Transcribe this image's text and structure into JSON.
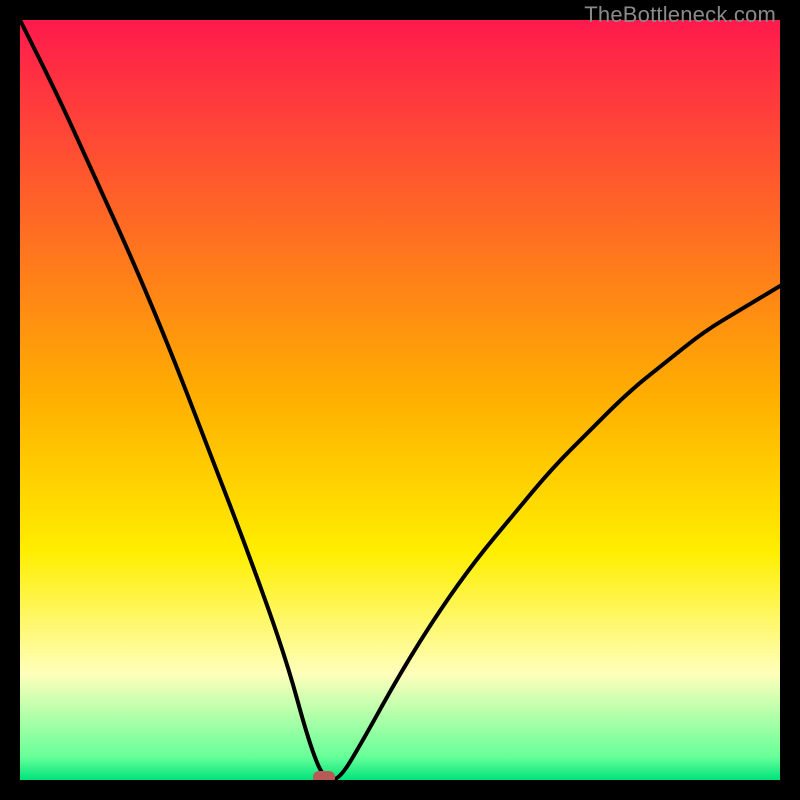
{
  "watermark": "TheBottleneck.com",
  "chart_data": {
    "type": "line",
    "title": "",
    "xlabel": "",
    "ylabel": "",
    "xlim": [
      0,
      100
    ],
    "ylim": [
      0,
      100
    ],
    "grid": false,
    "legend": false,
    "marker": {
      "x": 40,
      "y": 0,
      "color": "#b85a55"
    },
    "background_gradient": {
      "stops": [
        {
          "pos": 0.0,
          "color": "#ff1a4d"
        },
        {
          "pos": 0.5,
          "color": "#ffb000"
        },
        {
          "pos": 0.7,
          "color": "#ffee00"
        },
        {
          "pos": 0.86,
          "color": "#ffffbb"
        },
        {
          "pos": 0.97,
          "color": "#66ff99"
        },
        {
          "pos": 1.0,
          "color": "#00e47a"
        }
      ]
    },
    "series": [
      {
        "name": "curve",
        "x": [
          0,
          5,
          10,
          15,
          20,
          25,
          30,
          35,
          38,
          40,
          42,
          45,
          50,
          55,
          60,
          65,
          70,
          75,
          80,
          85,
          90,
          95,
          100
        ],
        "y": [
          100,
          90,
          79,
          68,
          56,
          43,
          30,
          16,
          5,
          0,
          0,
          5,
          14,
          22,
          29,
          35,
          41,
          46,
          51,
          55,
          59,
          62,
          65
        ]
      }
    ]
  }
}
